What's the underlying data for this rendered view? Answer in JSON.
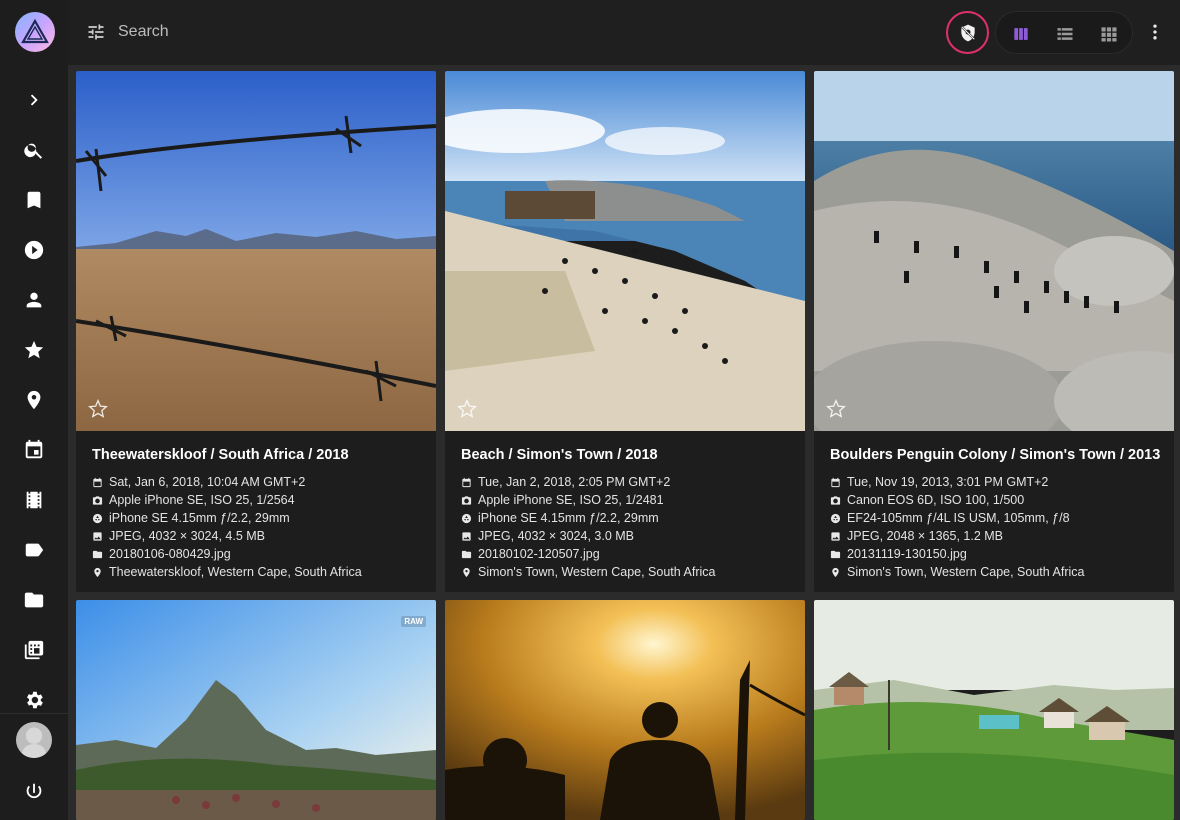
{
  "search": {
    "placeholder": "Search"
  },
  "sidebar": {
    "items": [
      {
        "icon": "chevron-right-icon",
        "label": "Expand"
      },
      {
        "icon": "search-icon",
        "label": "Search"
      },
      {
        "icon": "bookmark-icon",
        "label": "Albums"
      },
      {
        "icon": "play-icon",
        "label": "Videos"
      },
      {
        "icon": "person-icon",
        "label": "People"
      },
      {
        "icon": "star-icon",
        "label": "Favorites"
      },
      {
        "icon": "place-icon",
        "label": "Places"
      },
      {
        "icon": "calendar-icon",
        "label": "Calendar"
      },
      {
        "icon": "film-icon",
        "label": "Moments"
      },
      {
        "icon": "label-icon",
        "label": "Labels"
      },
      {
        "icon": "folder-icon",
        "label": "Folders"
      },
      {
        "icon": "library-icon",
        "label": "Library"
      },
      {
        "icon": "gear-icon",
        "label": "Settings"
      },
      {
        "icon": "power-icon",
        "label": "Logout"
      }
    ]
  },
  "toolbar": {
    "views": [
      "cards",
      "list",
      "mosaic"
    ],
    "active_view": "cards",
    "accent": "#8e5cd9",
    "privacy_accent": "#e0306a"
  },
  "cards": [
    {
      "title": "Theewaterskloof / South Africa / 2018",
      "date": "Sat, Jan 6, 2018, 10:04 AM GMT+2",
      "camera": "Apple iPhone SE, ISO 25, 1/2564",
      "lens": "iPhone SE 4.15mm ƒ/2.2, 29mm",
      "file": "JPEG, 4032 × 3024, 4.5 MB",
      "filename": "20180106-080429.jpg",
      "location": "Theewaterskloof, Western Cape, South Africa"
    },
    {
      "title": "Beach / Simon's Town / 2018",
      "date": "Tue, Jan 2, 2018, 2:05 PM GMT+2",
      "camera": "Apple iPhone SE, ISO 25, 1/2481",
      "lens": "iPhone SE 4.15mm ƒ/2.2, 29mm",
      "file": "JPEG, 4032 × 3024, 3.0 MB",
      "filename": "20180102-120507.jpg",
      "location": "Simon's Town, Western Cape, South Africa"
    },
    {
      "title": "Boulders Penguin Colony / Simon's Town / 2013",
      "date": "Tue, Nov 19, 2013, 3:01 PM GMT+2",
      "camera": "Canon EOS 6D, ISO 100, 1/500",
      "lens": "EF24-105mm ƒ/4L IS USM, 105mm, ƒ/8",
      "file": "JPEG, 2048 × 1365, 1.2 MB",
      "filename": "20131119-130150.jpg",
      "location": "Simon's Town, Western Cape, South Africa"
    }
  ],
  "second_row": {
    "raw_badge": "RAW"
  }
}
